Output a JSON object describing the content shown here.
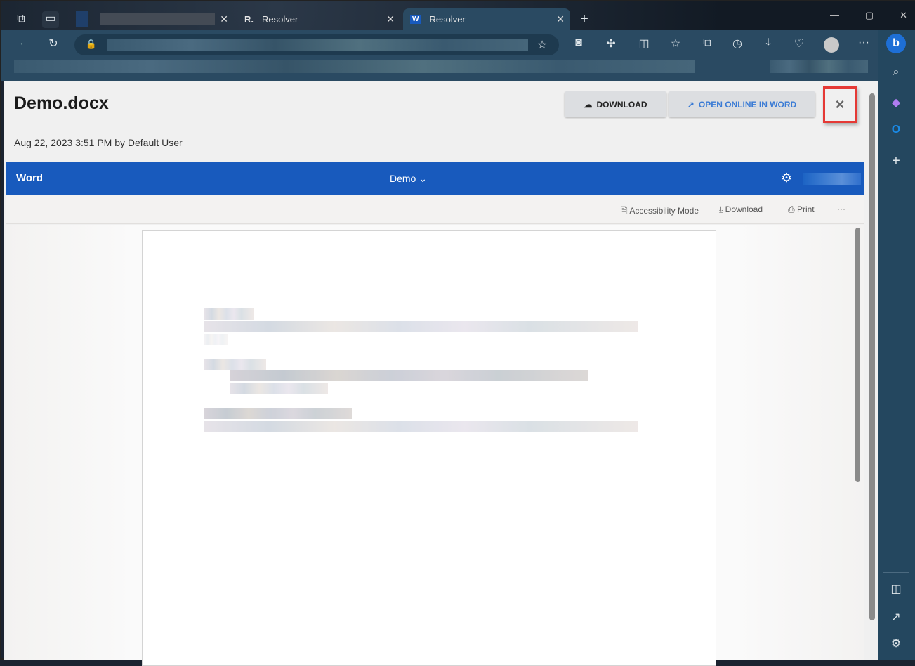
{
  "browser": {
    "tabs": [
      {
        "label": ""
      },
      {
        "label": "Resolver",
        "favicon": "R."
      },
      {
        "label": "Resolver",
        "favicon": "W"
      }
    ]
  },
  "viewer": {
    "title": "Demo.docx",
    "meta": "Aug 22, 2023 3:51 PM by Default User",
    "download_label": "DOWNLOAD",
    "open_online_label": "OPEN ONLINE IN WORD",
    "close_label": "×"
  },
  "word": {
    "app_name": "Word",
    "doc_name": "Demo",
    "accessibility": "Accessibility Mode",
    "download": "Download",
    "print": "Print",
    "more": "···"
  },
  "colors": {
    "word_blue": "#185abd",
    "accent_red": "#e53935"
  }
}
